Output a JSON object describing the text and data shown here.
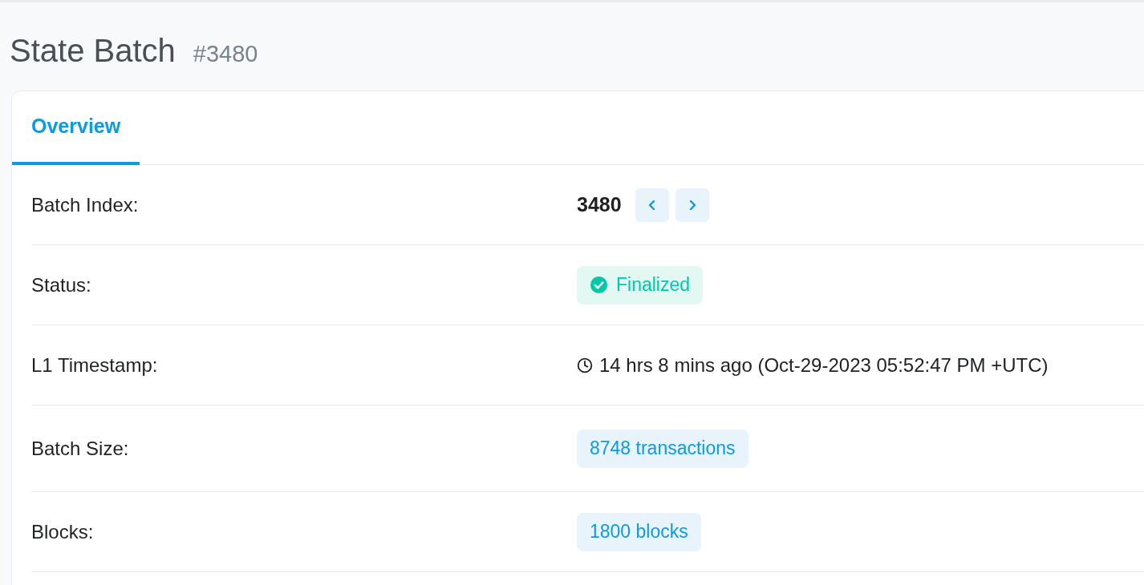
{
  "title": "State Batch",
  "batch_ref": "#3480",
  "tabs": [
    {
      "label": "Overview",
      "selected": true
    }
  ],
  "rows": [
    {
      "kind": "index",
      "label": "Batch Index:",
      "value": "3480"
    },
    {
      "kind": "status",
      "label": "Status:",
      "value": "Finalized"
    },
    {
      "kind": "time",
      "label": "L1 Timestamp:",
      "value": "14 hrs 8 mins ago (Oct-29-2023 05:52:47 PM +UTC)"
    },
    {
      "kind": "pill",
      "label": "Batch Size:",
      "value": "8748 transactions"
    },
    {
      "kind": "pill",
      "label": "Blocks:",
      "value": "1800 blocks"
    }
  ]
}
